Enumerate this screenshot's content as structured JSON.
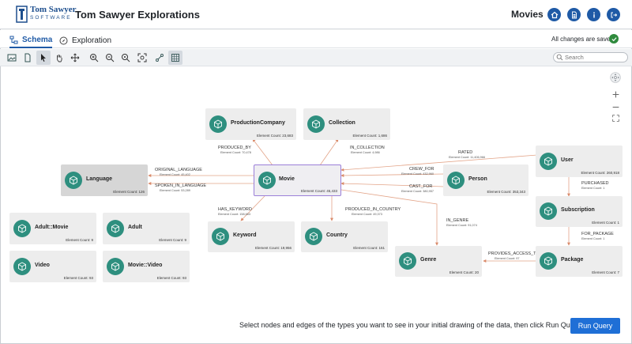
{
  "app": {
    "logo_line1": "Tom Sawyer",
    "logo_line2": "SOFTWARE",
    "title": "Tom Sawyer Explorations",
    "project": "Movies"
  },
  "tabs": [
    {
      "label": "Schema",
      "icon": "schema-icon",
      "active": true
    },
    {
      "label": "Exploration",
      "icon": "compass-icon",
      "active": false
    }
  ],
  "status": {
    "saved_text": "All changes are saved",
    "color": "#2f8a3d"
  },
  "search": {
    "placeholder": "Search"
  },
  "nodes": {
    "production_company": {
      "label": "ProductionCompany",
      "count": "Element Count: 23,683"
    },
    "collection": {
      "label": "Collection",
      "count": "Element Count: 1,686"
    },
    "language": {
      "label": "Language",
      "count": "Element Count: 126"
    },
    "movie": {
      "label": "Movie",
      "count": "Element Count: 45,433"
    },
    "person": {
      "label": "Person",
      "count": "Element Count: 353,343"
    },
    "user": {
      "label": "User",
      "count": "Element Count: 260,918"
    },
    "subscription": {
      "label": "Subscription",
      "count": "Element Count: 1"
    },
    "package": {
      "label": "Package",
      "count": "Element Count: 7"
    },
    "genre": {
      "label": "Genre",
      "count": "Element Count: 20"
    },
    "keyword": {
      "label": "Keyword",
      "count": "Element Count: 19,956"
    },
    "country": {
      "label": "Country",
      "count": "Element Count: 161"
    },
    "adult_movie": {
      "label": "Adult::Movie",
      "count": "Element Count: 9"
    },
    "adult": {
      "label": "Adult",
      "count": "Element Count: 9"
    },
    "video": {
      "label": "Video",
      "count": "Element Count: 93"
    },
    "movie_video": {
      "label": "Movie::Video",
      "count": "Element Count: 93"
    }
  },
  "edges": {
    "produced_by": {
      "label": "PRODUCED_BY",
      "count": "Element Count: 70,478"
    },
    "in_collection": {
      "label": "IN_COLLECTION",
      "count": "Element Count: 4,986"
    },
    "rated": {
      "label": "RATED",
      "count": "Element Count: 11,406,966"
    },
    "original_language": {
      "label": "ORIGINAL_LANGUAGE",
      "count": "Element Count: 45,402"
    },
    "spoken_in_language": {
      "label": "SPOKEN_IN_LANGUAGE",
      "count": "Element Count: 53,289"
    },
    "crew_for": {
      "label": "CREW_FOR",
      "count": "Element Count: 432,960"
    },
    "cast_for": {
      "label": "CAST_FOR",
      "count": "Element Count: 380,957"
    },
    "purchased": {
      "label": "PURCHASED",
      "count": "Element Count: 1"
    },
    "for_package": {
      "label": "FOR_PACKAGE",
      "count": "Element Count: 1"
    },
    "has_keyword": {
      "label": "HAS_KEYWORD",
      "count": "Element Count: 158,663"
    },
    "produced_in_country": {
      "label": "PRODUCED_IN_COUNTRY",
      "count": "Element Count: 49,373"
    },
    "in_genre": {
      "label": "IN_GENRE",
      "count": "Element Count: 91,074"
    },
    "provides_access_to": {
      "label": "PROVIDES_ACCESS_TO",
      "count": "Element Count: 97"
    }
  },
  "footer": {
    "hint": "Select nodes and edges of the types you want to see in your initial drawing of the data, then click Run Query.",
    "run_label": "Run Query"
  },
  "colors": {
    "accent": "#1f5aa6",
    "node_icon": "#2e8f7f",
    "edge": "#e8a080",
    "selected": "#9b7fd9",
    "run_button": "#1f6fd6"
  }
}
